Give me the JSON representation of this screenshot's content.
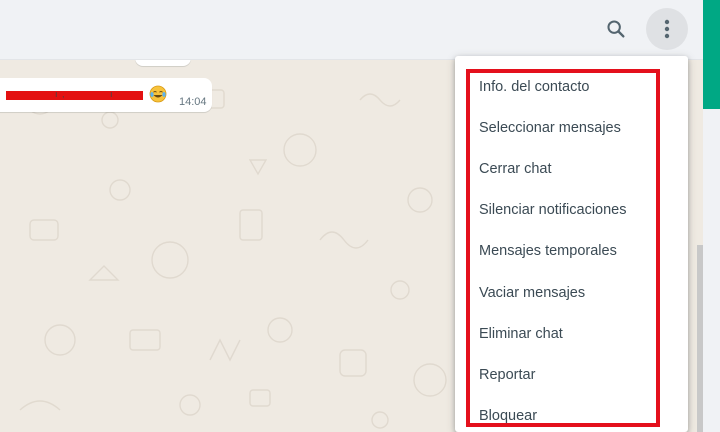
{
  "header": {
    "search_icon": "search-icon",
    "menu_icon": "kebab-menu-icon"
  },
  "message": {
    "emoji": "face-with-tears-of-joy",
    "time": "14:04"
  },
  "menu": {
    "items": [
      {
        "label": "Info. del contacto"
      },
      {
        "label": "Seleccionar mensajes"
      },
      {
        "label": "Cerrar chat"
      },
      {
        "label": "Silenciar notificaciones"
      },
      {
        "label": "Mensajes temporales"
      },
      {
        "label": "Vaciar mensajes"
      },
      {
        "label": "Eliminar chat"
      },
      {
        "label": "Reportar"
      },
      {
        "label": "Bloquear"
      }
    ]
  },
  "colors": {
    "accent": "#00a884",
    "highlight": "#e4101c",
    "chat_background": "#efeae2"
  }
}
